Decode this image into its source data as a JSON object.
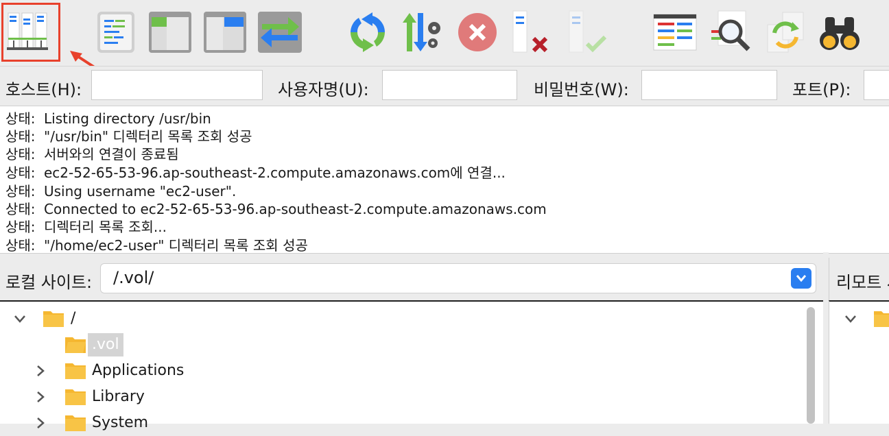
{
  "toolbar": {
    "icons": [
      "site-manager-icon",
      "message-log-icon",
      "local-tree-icon",
      "remote-tree-icon",
      "transfer-queue-icon",
      "refresh-icon",
      "process-queue-icon",
      "cancel-icon",
      "disconnect-icon",
      "reconnect-icon",
      "directory-listing-filters-icon",
      "search-remote-files-icon",
      "synchronized-browsing-icon",
      "find-files-icon"
    ],
    "highlight_color": "#e8412c"
  },
  "quickconnect": {
    "host_label": "호스트(H):",
    "user_label": "사용자명(U):",
    "pass_label": "비밀번호(W):",
    "port_label": "포트(P):",
    "host_value": "",
    "user_value": "",
    "pass_value": "",
    "port_value": ""
  },
  "log": {
    "prefix": "상태:",
    "lines": [
      "Listing directory /usr/bin",
      "\"/usr/bin\" 디렉터리 목록 조회 성공",
      "서버와의 연결이 종료됨",
      "ec2-52-65-53-96.ap-southeast-2.compute.amazonaws.com에 연결...",
      "Using username \"ec2-user\".",
      "Connected to ec2-52-65-53-96.ap-southeast-2.compute.amazonaws.com",
      "디렉터리 목록 조회...",
      "\"/home/ec2-user\" 디렉터리 목록 조회 성공"
    ]
  },
  "local": {
    "label": "로컬 사이트:",
    "path": "/.vol/",
    "tree": [
      {
        "label": "/",
        "expanded": true
      },
      {
        "label": ".vol",
        "selected": true
      },
      {
        "label": "Applications"
      },
      {
        "label": "Library"
      },
      {
        "label": "System"
      }
    ]
  },
  "remote": {
    "label": "리모트 사이트:"
  },
  "colors": {
    "accent": "#2a7ef0",
    "folder": "#f5b731"
  }
}
